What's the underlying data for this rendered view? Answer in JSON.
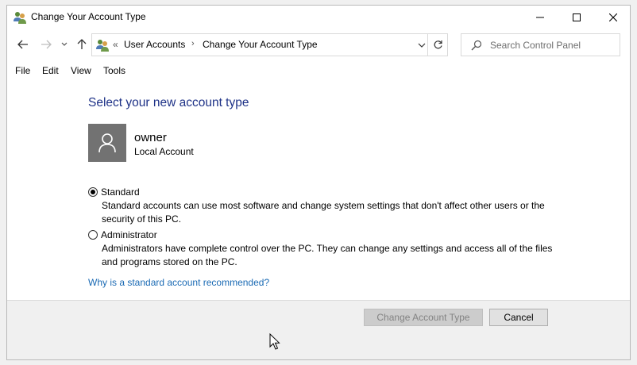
{
  "window": {
    "title": "Change Your Account Type",
    "icon": "user-accounts-icon"
  },
  "nav": {
    "breadcrumb": [
      "User Accounts",
      "Change Your Account Type"
    ],
    "overflow": "«",
    "crumb_separator": "›",
    "search_placeholder": "Search Control Panel"
  },
  "menu": [
    "File",
    "Edit",
    "View",
    "Tools"
  ],
  "main": {
    "heading": "Select your new account type",
    "user": {
      "name": "owner",
      "account_type": "Local Account"
    },
    "options": [
      {
        "label": "Standard",
        "description": "Standard accounts can use most software and change system settings that don't affect other users or the security of this PC.",
        "selected": true
      },
      {
        "label": "Administrator",
        "description": "Administrators have complete control over the PC. They can change any settings and access all of the files and programs stored on the PC.",
        "selected": false
      }
    ],
    "help_link": "Why is a standard account recommended?"
  },
  "footer": {
    "change_button": "Change Account Type",
    "change_button_enabled": false,
    "cancel_button": "Cancel"
  },
  "colors": {
    "heading": "#1e3287",
    "link": "#1a6ab4",
    "avatar_bg": "#727272",
    "footer_bg": "#f0f0f0"
  }
}
